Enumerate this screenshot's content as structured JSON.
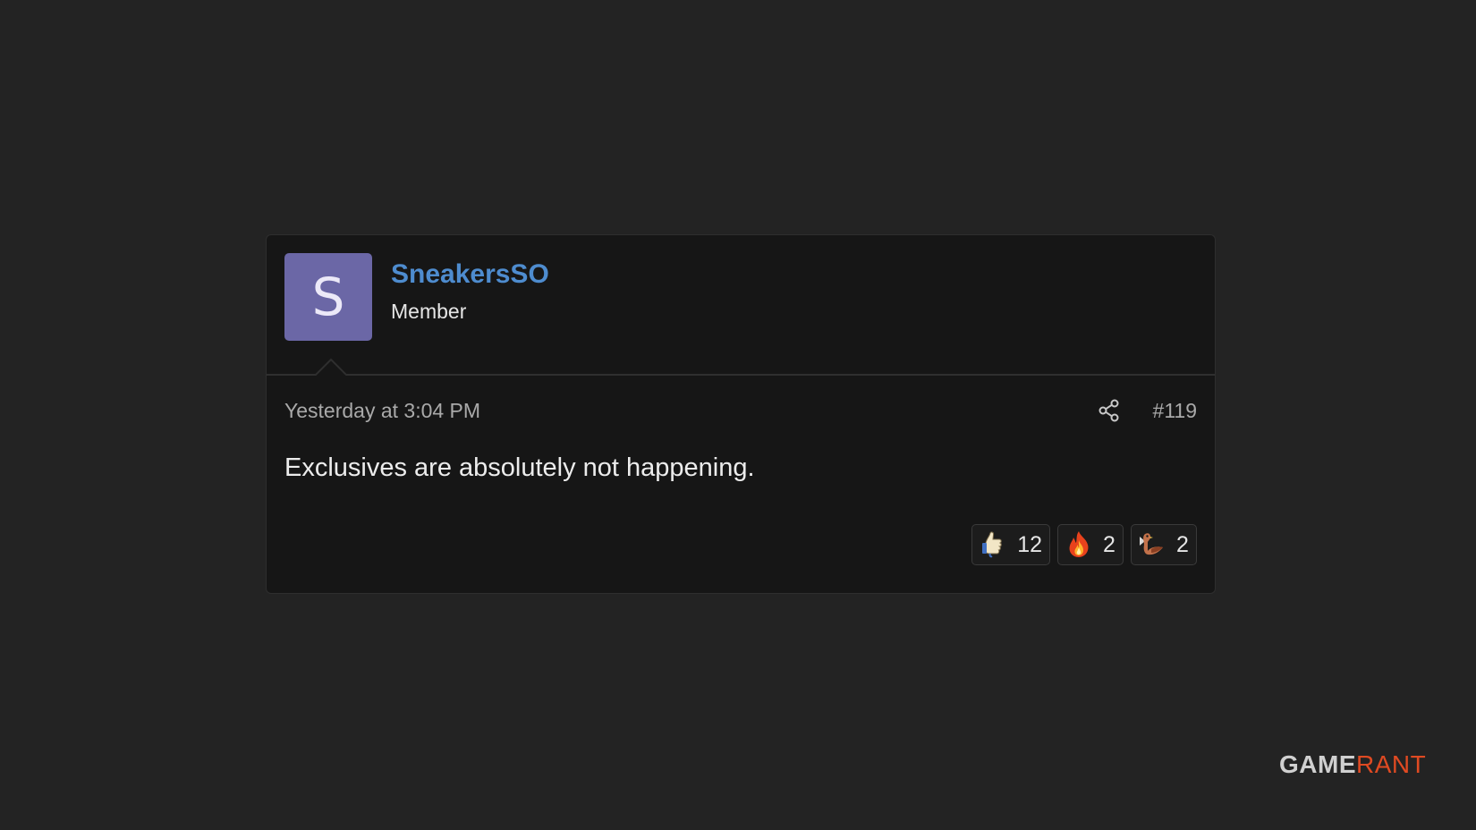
{
  "post": {
    "avatar_letter": "S",
    "username": "SneakersSO",
    "user_title": "Member",
    "timestamp": "Yesterday at 3:04 PM",
    "post_number": "#119",
    "body": "Exclusives are absolutely not happening.",
    "reactions": [
      {
        "icon": "thumbs-up-icon",
        "count": "12"
      },
      {
        "icon": "fire-icon",
        "count": "2"
      },
      {
        "icon": "bird-icon",
        "count": "2"
      }
    ]
  },
  "watermark": {
    "part1": "GAME",
    "part2": "RANT"
  },
  "colors": {
    "background": "#232323",
    "card": "#161616",
    "username": "#4e8ccf",
    "avatar": "#6b67a6",
    "logo_accent": "#e04a22"
  }
}
